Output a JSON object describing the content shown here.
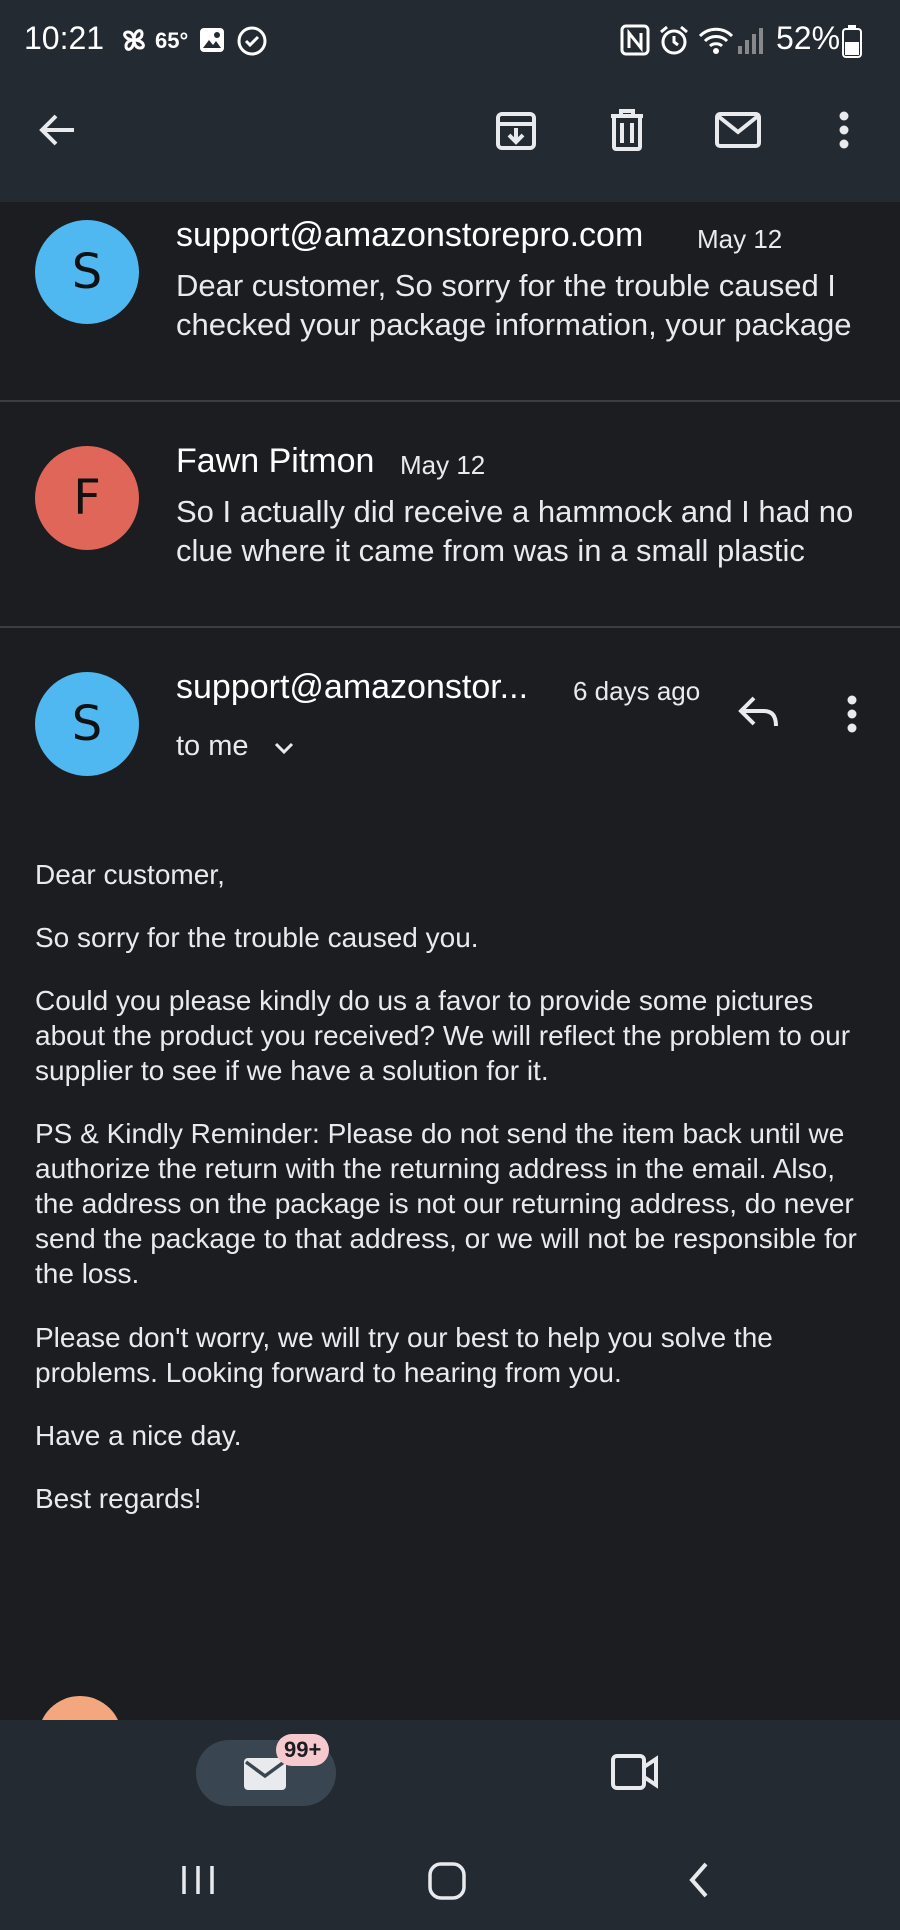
{
  "status_bar": {
    "time": "10:21",
    "weather": "65°",
    "battery": "52%",
    "icons": [
      "pinwheel-icon",
      "image-icon",
      "check-circle-icon",
      "nfc-icon",
      "alarm-icon",
      "wifi-icon",
      "signal-icon",
      "battery-icon"
    ]
  },
  "toolbar": {
    "icons": [
      "back-arrow-icon",
      "archive-icon",
      "delete-icon",
      "mark-unread-icon",
      "more-vert-icon"
    ]
  },
  "thread": [
    {
      "avatar_letter": "S",
      "avatar_color": "#4fb8f0",
      "sender": "support@amazonstorepro.com",
      "date": "May 12",
      "snippet": "Dear customer, So sorry for the trouble caused I checked your package information, your package"
    },
    {
      "avatar_letter": "F",
      "avatar_color": "#e0665a",
      "sender": "Fawn Pitmon",
      "date": "May 12",
      "snippet": "So I actually did receive a hammock and I had no clue where it came from was in a small plastic"
    }
  ],
  "open_message": {
    "avatar_letter": "S",
    "avatar_color": "#4fb8f0",
    "sender": "support@amazonstor...",
    "time": "6 days ago",
    "recipient": "to me",
    "body": [
      "Dear customer,",
      "So sorry for the trouble caused you.",
      "Could you please kindly do us a favor to provide some pictures about the product you received? We will reflect the problem to our supplier to see if we have a solution for it.",
      "PS & Kindly Reminder: Please do not send the item back until we authorize the return with the returning address in the email. Also, the address on the package is not our returning address, do never send the package to that address, or we will not be responsible for the loss.",
      "Please don't worry, we will try our best to help you solve the problems. Looking forward to hearing from you.",
      "Have a nice day.",
      "Best regards!"
    ]
  },
  "next_avatar_color": "#f4a77f",
  "bottom_nav": {
    "mail_badge": "99+",
    "active_pill_color": "#394651"
  },
  "colors": {
    "background": "#1b1d20",
    "bar": "#232a31",
    "text": "#e8eaed"
  }
}
